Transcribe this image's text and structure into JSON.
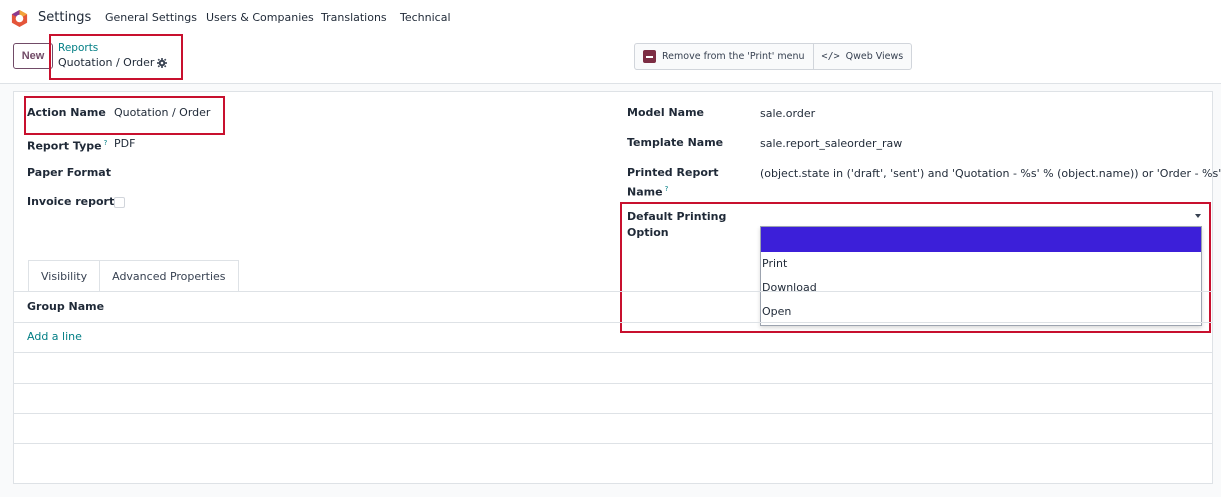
{
  "navbar": {
    "app_name": "Settings",
    "items": [
      "General Settings",
      "Users & Companies",
      "Translations",
      "Technical"
    ]
  },
  "control": {
    "new_label": "New",
    "breadcrumb_parent": "Reports",
    "breadcrumb_current": "Quotation / Order",
    "actions": {
      "remove_print": "Remove from the 'Print' menu",
      "qweb_views": "Qweb Views"
    }
  },
  "form": {
    "action_name_label": "Action Name",
    "action_name_value": "Quotation / Order",
    "report_type_label": "Report Type",
    "report_type_value": "PDF",
    "paper_format_label": "Paper Format",
    "invoice_report_label": "Invoice report",
    "model_name_label": "Model Name",
    "model_name_value": "sale.order",
    "template_name_label": "Template Name",
    "template_name_value": "sale.report_saleorder_raw",
    "printed_report_label_1": "Printed Report",
    "printed_report_label_2": "Name",
    "printed_report_value": "(object.state in ('draft', 'sent') and 'Quotation - %s' % (object.name)) or 'Order - %s' '",
    "default_printing_label_1": "Default Printing",
    "default_printing_label_2": "Option",
    "tooltip_mark": "?"
  },
  "dropdown": {
    "options": [
      "",
      "Print",
      "Download",
      "Open"
    ],
    "highlighted_index": 0,
    "highlight_color": "#3c1fd9"
  },
  "tabs": {
    "visibility": "Visibility",
    "advanced": "Advanced Properties"
  },
  "list": {
    "group_name_header": "Group Name",
    "add_line": "Add a line"
  },
  "colors": {
    "accent": "#714b67",
    "link": "#017e84",
    "annotation_red": "#c8102e"
  }
}
